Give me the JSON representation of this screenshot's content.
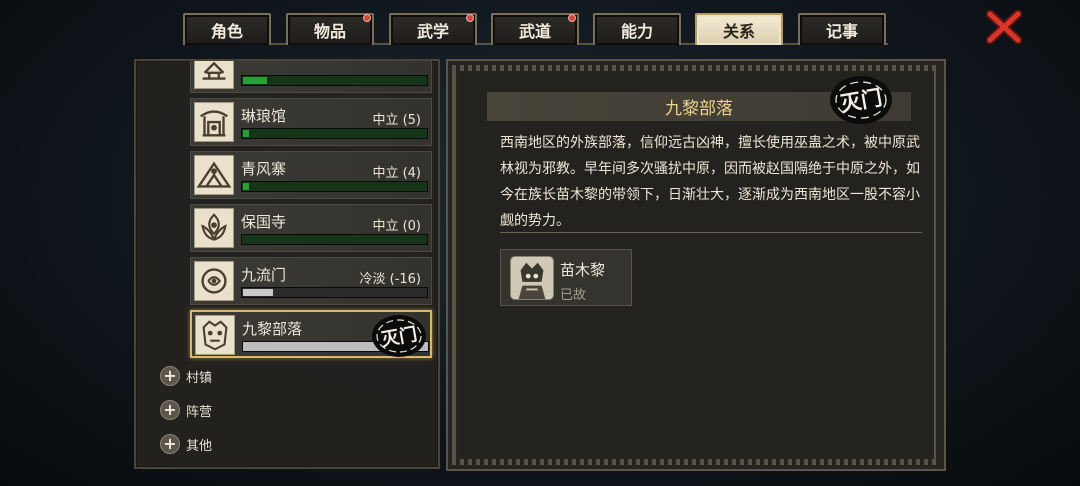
{
  "tabs": [
    {
      "label": "角色",
      "dot": false,
      "active": false
    },
    {
      "label": "物品",
      "dot": true,
      "active": false
    },
    {
      "label": "武学",
      "dot": true,
      "active": false
    },
    {
      "label": "武道",
      "dot": true,
      "active": false
    },
    {
      "label": "能力",
      "dot": false,
      "active": false
    },
    {
      "label": "关系",
      "dot": false,
      "active": true
    },
    {
      "label": "记事",
      "dot": false,
      "active": false
    }
  ],
  "factions": [
    {
      "name": "",
      "status": "",
      "reputation_fill": 0.13,
      "bar": "green",
      "icon": "pagoda-emblem-icon"
    },
    {
      "name": "琳琅馆",
      "status": "中立 (5)",
      "reputation_fill": 0.03,
      "bar": "green",
      "icon": "pavilion-emblem-icon"
    },
    {
      "name": "青风寨",
      "status": "中立 (4)",
      "reputation_fill": 0.03,
      "bar": "green",
      "icon": "fortress-emblem-icon"
    },
    {
      "name": "保国寺",
      "status": "中立 (0)",
      "reputation_fill": 0.0,
      "bar": "green",
      "icon": "lotus-emblem-icon"
    },
    {
      "name": "九流门",
      "status": "冷淡 (-16)",
      "reputation_fill": 0.16,
      "bar": "gray",
      "icon": "serpent-emblem-icon"
    },
    {
      "name": "九黎部落",
      "status": "",
      "reputation_fill": 1.0,
      "bar": "white",
      "icon": "mask-emblem-icon",
      "seal": "灭门",
      "selected": true
    }
  ],
  "categories": [
    {
      "label": "村镇"
    },
    {
      "label": "阵营"
    },
    {
      "label": "其他"
    }
  ],
  "detail": {
    "title": "九黎部落",
    "seal": "灭门",
    "description": "西南地区的外族部落，信仰远古凶神，擅长使用巫蛊之术，被中原武林视为邪教。早年间多次骚扰中原，因而被赵国隔绝于中原之外，如今在族长苗木黎的带领下，日渐壮大，逐渐成为西南地区一股不容小觑的势力。",
    "members": [
      {
        "name": "苗木黎",
        "status": "已故"
      }
    ]
  },
  "colors": {
    "accent_gold": "#d9b86a",
    "title_text": "#f0d48c",
    "bar_green": "#29a035",
    "bar_gray": "#c9c9c9",
    "close_red": "#d8352a"
  }
}
